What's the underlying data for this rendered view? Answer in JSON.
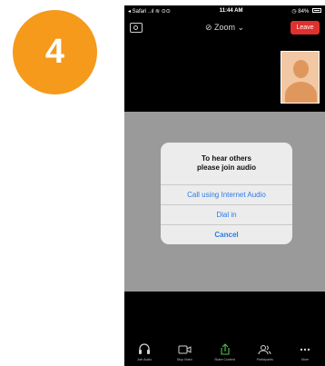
{
  "step_number": "4",
  "status_bar": {
    "carrier": "◂ Safari ..ıl ≋ ⊙⊙",
    "time": "11:44 AM",
    "battery": "◷ 84%"
  },
  "top_bar": {
    "title": "⊘ Zoom ⌄",
    "leave_label": "Leave"
  },
  "dialog": {
    "title_line1": "To hear others",
    "title_line2": "please join audio",
    "options": [
      {
        "label": "Call using Internet Audio"
      },
      {
        "label": "Dial in"
      },
      {
        "label": "Cancel"
      }
    ]
  },
  "toolbar": {
    "items": [
      {
        "label": "Join Audio",
        "icon": "headphones-icon"
      },
      {
        "label": "Stop Video",
        "icon": "video-camera-icon"
      },
      {
        "label": "Share Content",
        "icon": "share-icon"
      },
      {
        "label": "Participants",
        "icon": "participants-icon"
      },
      {
        "label": "More",
        "icon": "more-icon"
      }
    ]
  },
  "colors": {
    "badge": "#f59a1b",
    "leave": "#e0312e",
    "link": "#2f7ae5",
    "share": "#4fc24f"
  }
}
